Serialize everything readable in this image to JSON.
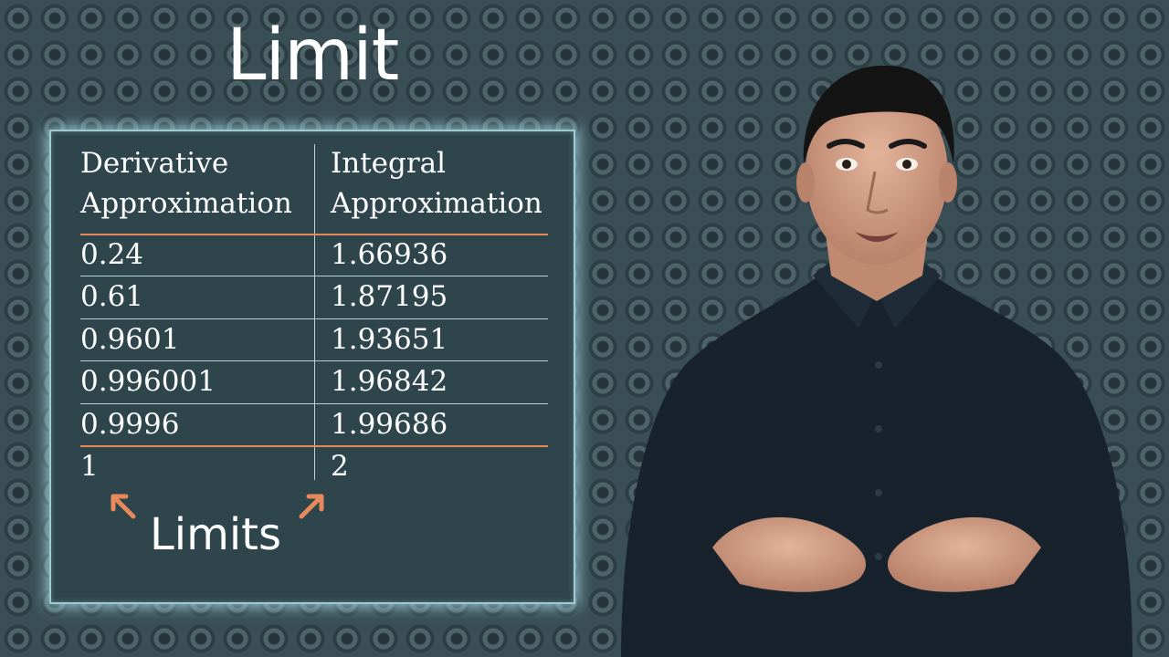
{
  "title": "Limit",
  "table": {
    "headers": [
      [
        "Derivative",
        "Approximation"
      ],
      [
        "Integral",
        "Approximation"
      ]
    ],
    "rows": [
      [
        "0.24",
        "1.66936"
      ],
      [
        "0.61",
        "1.87195"
      ],
      [
        "0.9601",
        "1.93651"
      ],
      [
        "0.996001",
        "1.96842"
      ],
      [
        "0.9996",
        "1.99686"
      ]
    ],
    "limits": [
      "1",
      "2"
    ]
  },
  "limits_label": "Limits",
  "colors": {
    "board": "#2e454c",
    "board_glow": "#9fc9d3",
    "divider_orange": "#e8895c",
    "arrow": "#e8895c"
  }
}
